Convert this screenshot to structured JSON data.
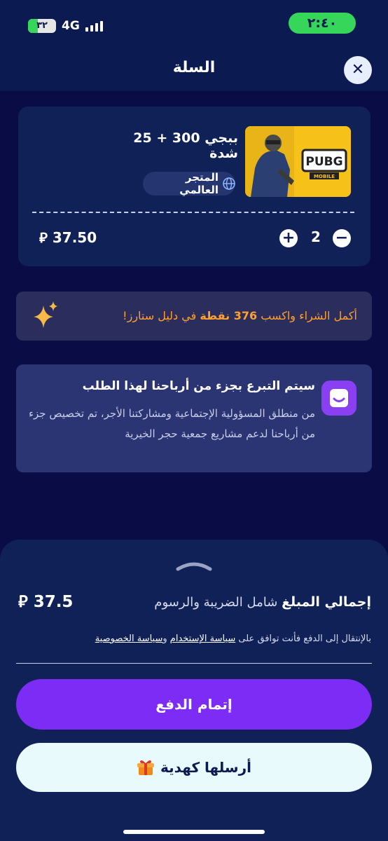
{
  "status_bar": {
    "time": "٢:٤٠",
    "battery": "٣٢",
    "network": "4G"
  },
  "header": {
    "title": "السلة",
    "close_symbol": "✕"
  },
  "cart_item": {
    "name": "ببجي 300 + 25 شدة",
    "store_label": "المتجر العالمي",
    "quantity": "2",
    "minus_symbol": "−",
    "plus_symbol": "+",
    "price": "37.50",
    "currency_symbol": "⃁"
  },
  "points_banner": {
    "prefix": "أكمل الشراء واكسب ",
    "points": "376 نقطة",
    "suffix": " في دليل ستارز!"
  },
  "donation": {
    "title": "سيتم التبرع بجزء من أرباحنا لهذا الطلب",
    "body": "من منطلق المسؤولية الإجتماعية ومشاركتنا الأجر، تم تخصيص جزء من أرباحنا لدعم مشاريع جمعية حجر الخيرية"
  },
  "summary": {
    "total_label_bold": "إجمالي المبلغ",
    "total_label_rest": " شامل الضريبة والرسوم",
    "total_amount": "37.5",
    "terms_prefix": "بالإنتقال إلى الدفع فأنت توافق على ",
    "terms_link": "سياسة الإستخدام",
    "terms_and": " و",
    "privacy_link": "سياسة الخصوصية"
  },
  "actions": {
    "pay_label": "إتمام الدفع",
    "gift_label": "أرسلها كهدية"
  },
  "icons": {
    "sparkle": "sparkle-icon",
    "gift": "gift-icon",
    "globe": "globe-icon",
    "donation": "smile-icon"
  },
  "colors": {
    "background": "#0a0c45",
    "card": "#0f2156",
    "accent_purple": "#7c2cf5",
    "points_orange": "#ff9f2d",
    "status_green": "#35d65a"
  }
}
